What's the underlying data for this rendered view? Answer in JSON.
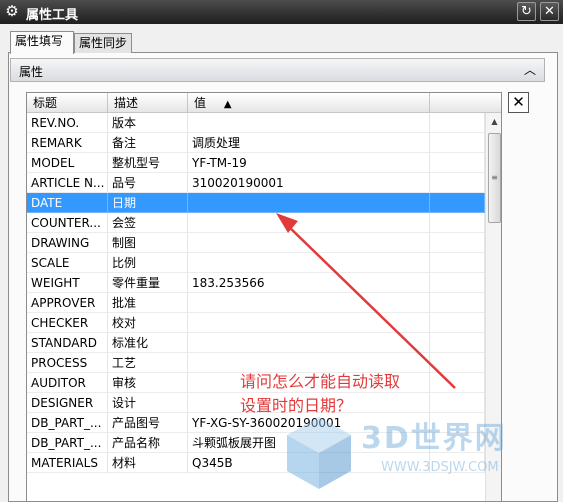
{
  "window": {
    "title": "属性工具"
  },
  "tabs": [
    {
      "label": "属性填写",
      "active": true
    },
    {
      "label": "属性同步",
      "active": false
    }
  ],
  "group": {
    "label": "属性"
  },
  "table": {
    "columns": [
      {
        "label": "标题"
      },
      {
        "label": "描述"
      },
      {
        "label": "值"
      }
    ],
    "sort_indicator": "▲",
    "rows": [
      {
        "title": "REV.NO.",
        "desc": "版本",
        "value": ""
      },
      {
        "title": "REMARK",
        "desc": "备注",
        "value": "调质处理"
      },
      {
        "title": "MODEL",
        "desc": "整机型号",
        "value": "YF-TM-19"
      },
      {
        "title": "ARTICLE N...",
        "desc": "品号",
        "value": "310020190001"
      },
      {
        "title": "DATE",
        "desc": "日期",
        "value": "",
        "selected": true
      },
      {
        "title": "COUNTER...",
        "desc": "会签",
        "value": ""
      },
      {
        "title": "DRAWING",
        "desc": "制图",
        "value": ""
      },
      {
        "title": "SCALE",
        "desc": "比例",
        "value": ""
      },
      {
        "title": "WEIGHT",
        "desc": "零件重量",
        "value": "183.253566"
      },
      {
        "title": "APPROVER",
        "desc": "批准",
        "value": ""
      },
      {
        "title": "CHECKER",
        "desc": "校对",
        "value": ""
      },
      {
        "title": "STANDARD",
        "desc": "标准化",
        "value": ""
      },
      {
        "title": "PROCESS",
        "desc": "工艺",
        "value": ""
      },
      {
        "title": "AUDITOR",
        "desc": "审核",
        "value": ""
      },
      {
        "title": "DESIGNER",
        "desc": "设计",
        "value": ""
      },
      {
        "title": "DB_PART_...",
        "desc": "产品图号",
        "value": "YF-XG-SY-360020190001"
      },
      {
        "title": "DB_PART_...",
        "desc": "产品名称",
        "value": "斗颗弧板展开图"
      },
      {
        "title": "MATERIALS",
        "desc": "材料",
        "value": "Q345B"
      }
    ]
  },
  "annotation": {
    "line1": "请问怎么才能自动读取",
    "line2": "设置时的日期？",
    "color": "#e23a3a"
  },
  "watermark": {
    "logo": "3D世界网",
    "url": "WWW.3DSJW.COM"
  },
  "colors": {
    "selection": "#3399ff",
    "titlebar": "#2a2a2a"
  }
}
